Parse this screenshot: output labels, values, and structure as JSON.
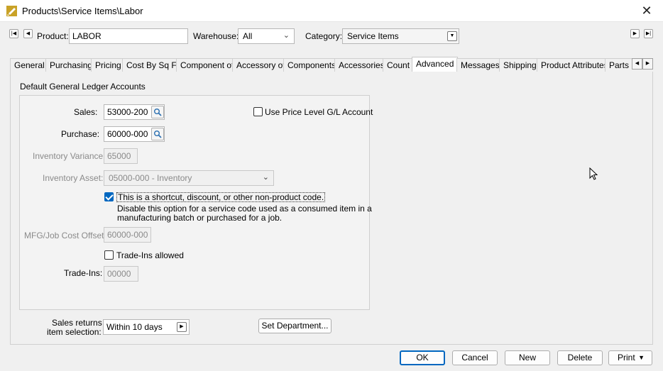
{
  "window": {
    "title": "Products\\Service Items\\Labor",
    "close_glyph": "✕"
  },
  "header": {
    "product_label": "Product:",
    "product_value": "LABOR",
    "warehouse_label": "Warehouse:",
    "warehouse_value": "All",
    "category_label": "Category:",
    "category_value": "Service Items"
  },
  "tabs": [
    {
      "label": "General"
    },
    {
      "label": "Purchasing"
    },
    {
      "label": "Pricing"
    },
    {
      "label": "Cost By Sq Ft"
    },
    {
      "label": "Component of"
    },
    {
      "label": "Accessory of"
    },
    {
      "label": "Components"
    },
    {
      "label": "Accessories"
    },
    {
      "label": "Count"
    },
    {
      "label": "Advanced"
    },
    {
      "label": "Messages"
    },
    {
      "label": "Shipping"
    },
    {
      "label": "Product Attributes"
    },
    {
      "label": "Parts Cross-Ref"
    }
  ],
  "advanced": {
    "group_title": "Default General Ledger Accounts",
    "sales_label": "Sales:",
    "sales_value": "53000-200",
    "purchase_label": "Purchase:",
    "purchase_value": "60000-000",
    "use_price_level_label": "Use Price Level G/L Account",
    "inventory_variance_label": "Inventory Variance:",
    "inventory_variance_value": "65000",
    "inventory_asset_label": "Inventory Asset:",
    "inventory_asset_value": "05000-000 - Inventory",
    "shortcut_label": "This is a shortcut, discount, or other non-product code.",
    "shortcut_help_1": "Disable this option for a service code used as a consumed item in a",
    "shortcut_help_2": "manufacturing batch or purchased for a job.",
    "mfg_label": "MFG/Job Cost Offset",
    "mfg_value": "60000-000",
    "tradeins_allowed_label": "Trade-Ins allowed",
    "tradeins_label": "Trade-Ins:",
    "tradeins_value": "00000",
    "sales_returns_label_1": "Sales returns",
    "sales_returns_label_2": "item selection:",
    "sales_returns_value": "Within 10   days",
    "set_department_label": "Set Department..."
  },
  "footer": {
    "ok": "OK",
    "cancel": "Cancel",
    "new": "New",
    "delete": "Delete",
    "print": "Print"
  },
  "colors": {
    "accent": "#0067c0"
  }
}
